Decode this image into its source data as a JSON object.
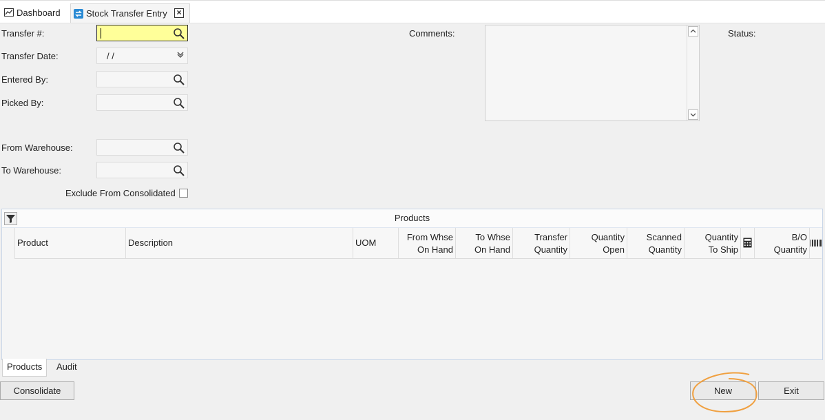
{
  "tabs": {
    "dashboard": "Dashboard",
    "stock_transfer": "Stock Transfer Entry",
    "close": "×"
  },
  "form": {
    "transfer_no_label": "Transfer #:",
    "transfer_date_label": "Transfer Date:",
    "transfer_date_value": "/  /",
    "entered_by_label": "Entered By:",
    "picked_by_label": "Picked By:",
    "from_warehouse_label": "From Warehouse:",
    "to_warehouse_label": "To Warehouse:",
    "exclude_label": "Exclude From Consolidated",
    "comments_label": "Comments:",
    "status_label": "Status:"
  },
  "grid": {
    "title": "Products",
    "columns": [
      {
        "line1": "Product",
        "line2": ""
      },
      {
        "line1": "Description",
        "line2": ""
      },
      {
        "line1": "UOM",
        "line2": ""
      },
      {
        "line1": "From Whse",
        "line2": "On Hand"
      },
      {
        "line1": "To Whse",
        "line2": "On Hand"
      },
      {
        "line1": "Transfer",
        "line2": "Quantity"
      },
      {
        "line1": "Quantity",
        "line2": "Open"
      },
      {
        "line1": "Scanned",
        "line2": "Quantity"
      },
      {
        "line1": "Quantity",
        "line2": "To Ship"
      },
      {
        "line1": "B/O",
        "line2": "Quantity"
      }
    ]
  },
  "bottom_tabs": [
    "Products",
    "Audit"
  ],
  "buttons": {
    "consolidate": "Consolidate",
    "new": "New",
    "exit": "Exit"
  },
  "colors": {
    "active_field": "#ffff99",
    "highlight_ring": "#f0a040"
  }
}
